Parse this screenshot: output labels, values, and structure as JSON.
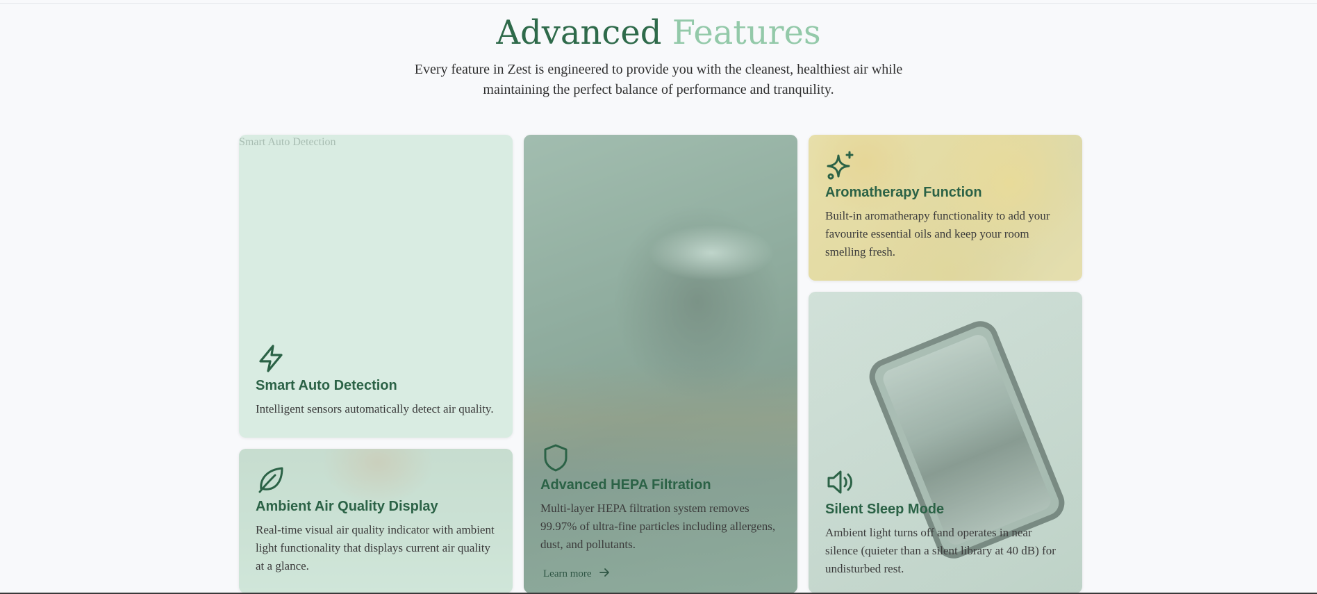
{
  "section": {
    "title_part1": "Advanced",
    "title_part2": "Features",
    "subtitle": "Every feature in Zest is engineered to provide you with the cleanest, healthiest air while maintaining the perfect balance of performance and tranquility."
  },
  "features": {
    "smart_auto_detection": {
      "image_alt": "Smart Auto Detection",
      "icon": "lightning-icon",
      "title": "Smart Auto Detection",
      "description": "Intelligent sensors automatically detect air quality."
    },
    "hepa_filtration": {
      "icon": "shield-icon",
      "title": "Advanced HEPA Filtration",
      "description": "Multi-layer HEPA filtration system removes 99.97% of ultra-fine particles including allergens, dust, and pollutants.",
      "link_label": "Learn more"
    },
    "aromatherapy": {
      "icon": "sparkles-icon",
      "title": "Aromatherapy Function",
      "description": "Built-in aromatherapy functionality to add your favourite essential oils and keep your room smelling fresh."
    },
    "silent_sleep": {
      "icon": "speaker-icon",
      "title": "Silent Sleep Mode",
      "description": "Ambient light turns off and operates in near silence (quieter than a silent library at 40 dB) for undisturbed rest."
    },
    "ambient_display": {
      "icon": "leaf-icon",
      "title": "Ambient Air Quality Display",
      "description": "Real-time visual air quality indicator with ambient light functionality that displays current air quality at a glance."
    }
  },
  "colors": {
    "title_dark": "#2e6a4a",
    "title_light": "#93c9a9",
    "card_heading": "#2b6246"
  }
}
